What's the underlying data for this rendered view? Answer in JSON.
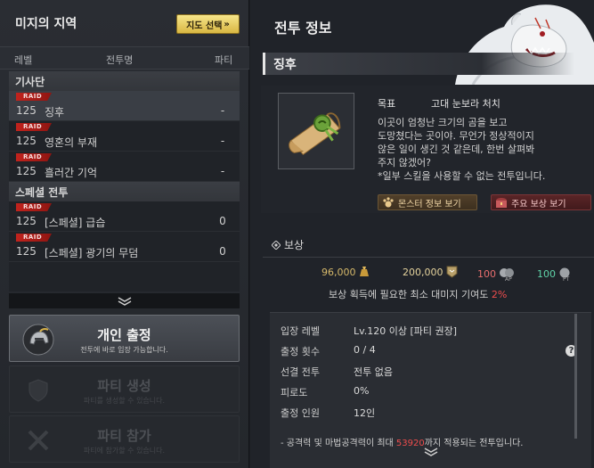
{
  "left": {
    "title": "미지의 지역",
    "map_button": "지도 선택",
    "map_button_icon": "double-chevron-right-icon",
    "columns": {
      "level": "레벨",
      "name": "전투명",
      "party": "파티"
    },
    "groups": [
      {
        "name": "기사단",
        "rows": [
          {
            "badge": "RAID",
            "level": "125",
            "name": "징후",
            "party": "-"
          },
          {
            "badge": "RAID",
            "level": "125",
            "name": "영혼의 부재",
            "party": "-"
          },
          {
            "badge": "RAID",
            "level": "125",
            "name": "흘러간 기억",
            "party": "-"
          }
        ]
      },
      {
        "name": "스페셜 전투",
        "rows": [
          {
            "badge": "RAID",
            "level": "125",
            "name": "[스페셜] 급습",
            "party": "0"
          },
          {
            "badge": "RAID",
            "level": "125",
            "name": "[스페셜] 광기의 무덤",
            "party": "0"
          }
        ]
      }
    ],
    "scroll_icon": "double-chevron-down-icon",
    "buttons": [
      {
        "title": "개인 출정",
        "subtitle": "전투에 바로 입장 가능합니다.",
        "icon": "knight-helmet-icon",
        "enabled": true
      },
      {
        "title": "파티 생성",
        "subtitle": "파티를 생성할 수 있습니다.",
        "icon": "party-shield-icon",
        "enabled": false
      },
      {
        "title": "파티 참가",
        "subtitle": "파티에 참가할 수 있습니다.",
        "icon": "crossed-swords-icon",
        "enabled": false
      }
    ]
  },
  "right": {
    "title": "전투 정보",
    "subtitle": "징후",
    "goal_label": "목표",
    "goal_value": "고대 눈보라 처치",
    "description": "이곳이 엄청난 크기의 곰을 보고\n도망쳤다는 곳이야. 무언가 정상적이지\n않은 일이 생긴 것 같은데, 한번 살펴봐\n주지 않겠어?\n*일부 스킬을 사용할 수 없는 전투입니다.",
    "monster_button": "몬스터 정보 보기",
    "reward_button": "주요 보상 보기",
    "reward_title": "보상",
    "rewards": [
      {
        "value": "96,000",
        "icon": "gold-pouch-icon"
      },
      {
        "value": "200,000",
        "icon": "experience-badge-icon"
      },
      {
        "value": "100",
        "icon": "ap-orb-icon",
        "tag": "AP"
      },
      {
        "value": "100",
        "icon": "pt-orb-icon",
        "tag": "PT"
      }
    ],
    "min_damage_text": "보상 획득에 필요한 최소 대미지 기여도",
    "min_damage_value": "2%",
    "details": [
      {
        "label": "입장 레벨",
        "value": "Lv.120 이상 [파티 권장]"
      },
      {
        "label": "출정 횟수",
        "value": "0 / 4"
      },
      {
        "label": "선결 전투",
        "value": "전투 없음"
      },
      {
        "label": "피로도",
        "value": "0%"
      },
      {
        "label": "출정 인원",
        "value": "12인"
      }
    ],
    "note_prefix": "- 공격력 및 마법공격력이 최대 ",
    "note_value": "53920",
    "note_suffix": "까지 적용되는 전투입니다.",
    "colors": {
      "accent_red": "#ee4d4d",
      "gold": "#d6b96a",
      "ap": "#e96e6e",
      "pt": "#5fd3a8",
      "raid": "#c2231d"
    }
  }
}
